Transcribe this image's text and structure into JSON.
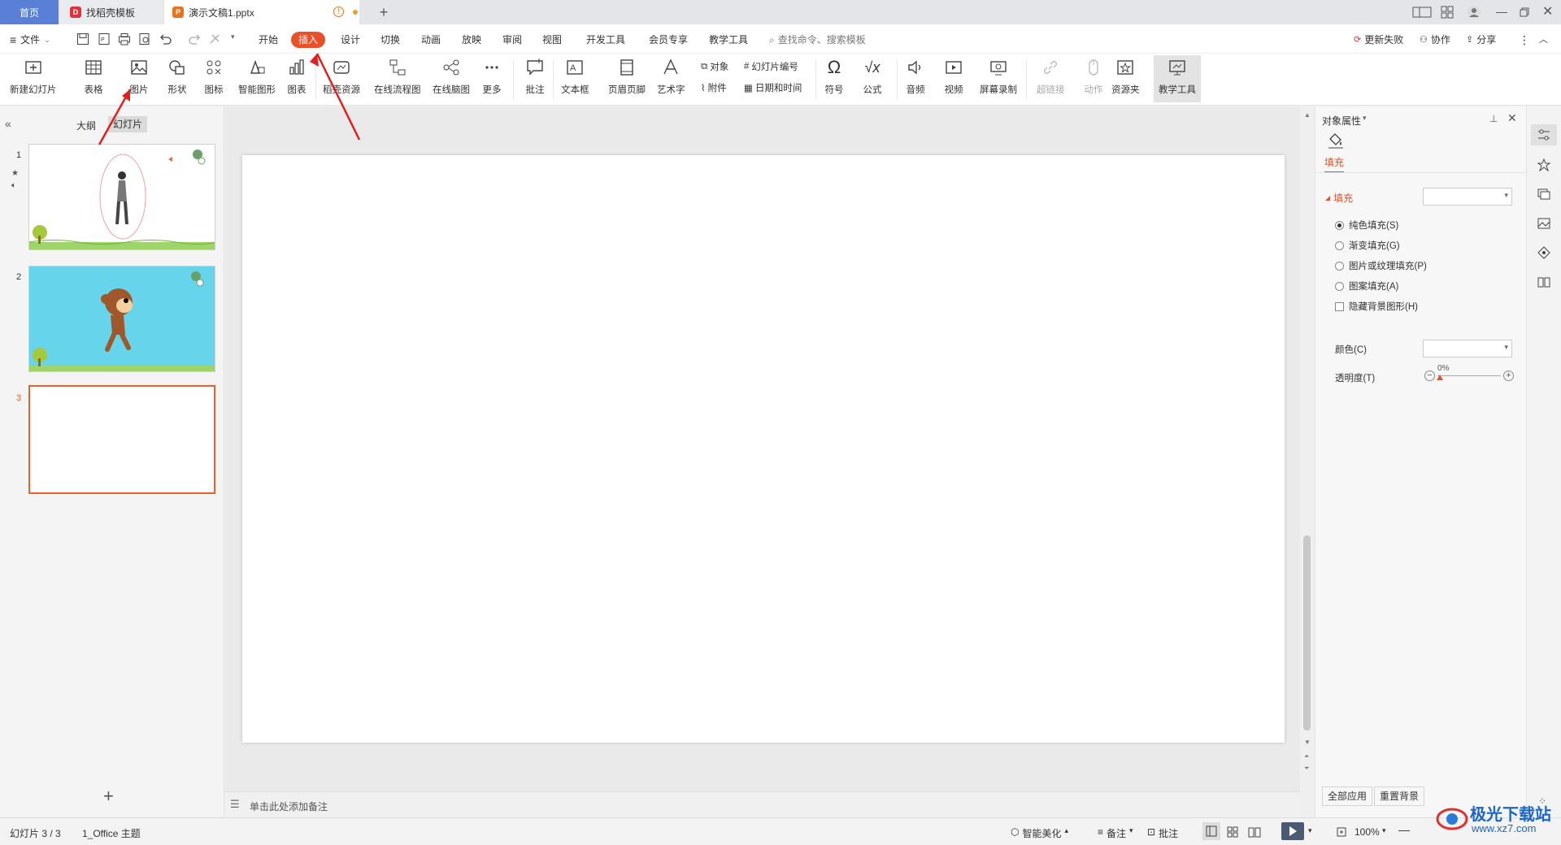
{
  "tabs": {
    "home": "首页",
    "template": "找稻壳模板",
    "document": "演示文稿1.pptx",
    "new_tab": "+"
  },
  "menu": {
    "file": "文件",
    "items": [
      "开始",
      "插入",
      "设计",
      "切换",
      "动画",
      "放映",
      "审阅",
      "视图",
      "开发工具",
      "会员专享",
      "教学工具"
    ],
    "active": "插入",
    "search_placeholder": "查找命令、搜索模板",
    "update_failed": "更新失败",
    "collaborate": "协作",
    "share": "分享"
  },
  "ribbon": {
    "new_slide": "新建幻灯片",
    "table": "表格",
    "picture": "图片",
    "shape": "形状",
    "icon": "图标",
    "smart_graphic": "智能图形",
    "chart": "图表",
    "docer_resources": "稻壳资源",
    "online_flowchart": "在线流程图",
    "online_mindmap": "在线脑图",
    "more": "更多",
    "comment": "批注",
    "textbox": "文本框",
    "header_footer": "页眉页脚",
    "wordart": "艺术字",
    "object": "对象",
    "slide_number": "幻灯片编号",
    "attachment": "附件",
    "date_time": "日期和时间",
    "symbol": "符号",
    "formula": "公式",
    "audio": "音频",
    "video": "视频",
    "screen_record": "屏幕录制",
    "hyperlink": "超链接",
    "action": "动作",
    "resource_folder": "资源夹",
    "teaching_tools": "教学工具"
  },
  "left_panel": {
    "outline_tab": "大纲",
    "slides_tab": "幻灯片",
    "slide_numbers": [
      "1",
      "2",
      "3"
    ],
    "add_slide": "+"
  },
  "notes": {
    "placeholder": "单击此处添加备注"
  },
  "right_panel": {
    "title": "对象属性",
    "fill_tab": "填充",
    "fill_section": "填充",
    "options": [
      "纯色填充(S)",
      "渐变填充(G)",
      "图片或纹理填充(P)",
      "图案填充(A)"
    ],
    "selected_option": "纯色填充(S)",
    "hide_bg": "隐藏背景图形(H)",
    "color_label": "颜色(C)",
    "transparency_label": "透明度(T)",
    "transparency_value": "0%",
    "apply_all": "全部应用",
    "reset_bg": "重置背景"
  },
  "status": {
    "slide_count": "幻灯片 3 / 3",
    "theme": "1_Office 主题",
    "smart_beautify": "智能美化",
    "notes": "备注",
    "comments": "批注",
    "zoom": "100%"
  },
  "watermark": {
    "brand": "极光下载站",
    "url": "www.xz7.com"
  },
  "colors": {
    "accent": "#e8502a",
    "home_tab": "#5a7fd6",
    "selected_thumb_border": "#e8602c",
    "slide2_bg": "#66d5eb"
  }
}
